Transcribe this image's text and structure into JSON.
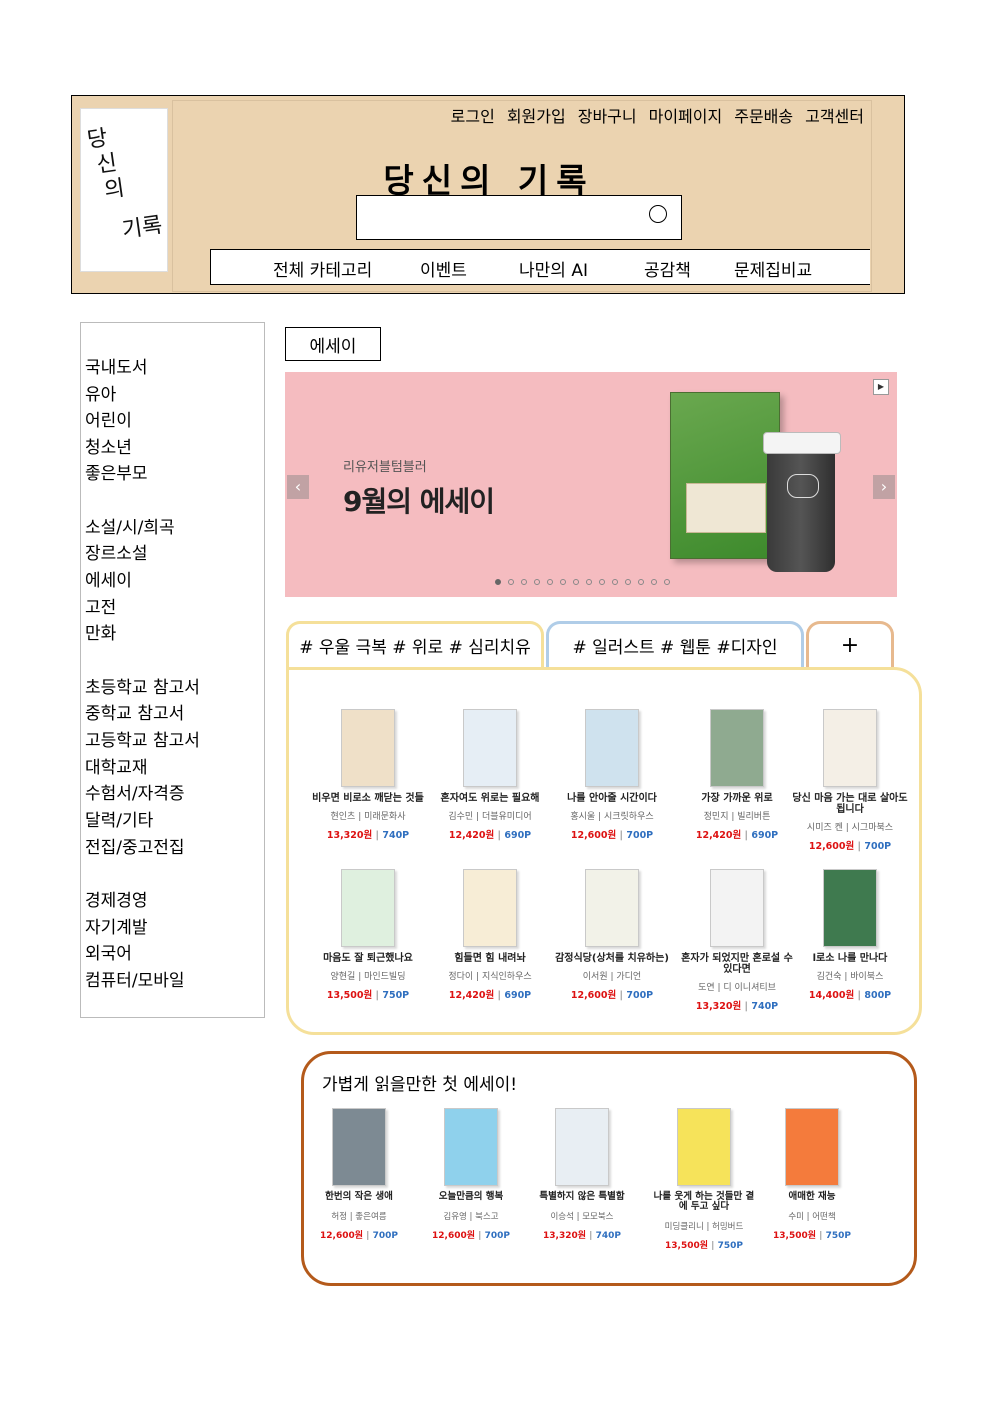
{
  "header": {
    "logo_lines": [
      "당",
      "신",
      "의",
      "기록"
    ],
    "top_links": [
      "로그인",
      "회원가입",
      "장바구니",
      "마이페이지",
      "주문배송",
      "고객센터"
    ],
    "site_title": "당신의 기록",
    "search": {
      "value": "",
      "icon": "search-icon"
    },
    "nav": [
      "전체 카테고리",
      "이벤트",
      "나만의 AI",
      "공감책",
      "문제집비교"
    ],
    "bg_color": "#ebd3b0"
  },
  "sidebar": {
    "groups": [
      [
        "국내도서",
        "유아",
        "어린이",
        "청소년",
        "좋은부모"
      ],
      [
        "소설/시/희곡",
        "장르소설",
        "에세이",
        "고전",
        "만화"
      ],
      [
        "초등학교 참고서",
        "중학교 참고서",
        "고등학교 참고서",
        "대학교재",
        "수험서/자격증",
        "달력/기타",
        "전집/중고전집"
      ],
      [
        "경제경영",
        "자기계발",
        "외국어",
        "컴퓨터/모바일"
      ]
    ]
  },
  "section_label": "에세이",
  "banner": {
    "subtitle": "리유저블텀블러",
    "title": "9월의 에세이",
    "prev": "‹",
    "next": "›",
    "play": "▶",
    "dots": 14,
    "active_dot": 0,
    "bg_color": "#f5bcc0"
  },
  "tabs": [
    {
      "label": "# 우울 극복 # 위로 # 심리치유",
      "border_color": "#f5e09a"
    },
    {
      "label": "# 일러스트 # 웹툰 #디자인",
      "border_color": "#b0cde8"
    },
    {
      "label": "+",
      "border_color": "#e7b98e"
    }
  ],
  "books": [
    {
      "title": "비우면 비로소 깨닫는 것들",
      "author": "현인츠",
      "publisher": "미래문화사",
      "price": "13,320원",
      "points": "740P",
      "cover": "#efe0c8"
    },
    {
      "title": "혼자여도 위로는 필요해",
      "author": "김수민",
      "publisher": "더블유미디어",
      "price": "12,420원",
      "points": "690P",
      "cover": "#e6eef5"
    },
    {
      "title": "나를 안아줄 시간이다",
      "author": "홍시울",
      "publisher": "시크릿하우스",
      "price": "12,600원",
      "points": "700P",
      "cover": "#cfe2ee"
    },
    {
      "title": "가장 가까운 위로",
      "author": "정민지",
      "publisher": "빌리버튼",
      "price": "12,420원",
      "points": "690P",
      "cover": "#8faa90"
    },
    {
      "title": "당신 마음 가는 대로 살아도 됩니다",
      "author": "시미즈 켄",
      "publisher": "시그마북스",
      "price": "12,600원",
      "points": "700P",
      "cover": "#f4efe6"
    },
    {
      "title": "마음도 잘 퇴근했나요",
      "author": "양현길",
      "publisher": "마인드빌딩",
      "price": "13,500원",
      "points": "750P",
      "cover": "#dff0df"
    },
    {
      "title": "힘들면 힘 내려놔",
      "author": "정다이",
      "publisher": "지식인하우스",
      "price": "12,420원",
      "points": "690P",
      "cover": "#f7edd6"
    },
    {
      "title": "감정식당(상처를 치유하는)",
      "author": "이서원",
      "publisher": "가디언",
      "price": "12,600원",
      "points": "700P",
      "cover": "#f2f2e8"
    },
    {
      "title": "혼자가 되었지만 혼로설 수 있다면",
      "author": "도연",
      "publisher": "디 이니셔티브",
      "price": "13,320원",
      "points": "740P",
      "cover": "#f3f3f3"
    },
    {
      "title": "l로소 나를 만나다",
      "author": "김건숙",
      "publisher": "바이북스",
      "price": "14,400원",
      "points": "800P",
      "cover": "#3f7a4f"
    }
  ],
  "light_essay": {
    "title": "가볍게 읽을만한 첫 에세이!",
    "books": [
      {
        "title": "한번의 작은 생애",
        "author": "허정",
        "publisher": "좋은여름",
        "price": "12,600원",
        "points": "700P",
        "cover": "#7d8a93"
      },
      {
        "title": "오늘만큼의 행복",
        "author": "김유영",
        "publisher": "북스고",
        "price": "12,600원",
        "points": "700P",
        "cover": "#8fd1ec"
      },
      {
        "title": "특별하지 않은 특별함",
        "author": "이승석",
        "publisher": "모모북스",
        "price": "13,320원",
        "points": "740P",
        "cover": "#e8eef3"
      },
      {
        "title": "나를 웃게 하는 것들만 곁에 두고 싶다",
        "author": "미딩클리니",
        "publisher": "허밍버드",
        "price": "13,500원",
        "points": "750P",
        "cover": "#f6e35a"
      },
      {
        "title": "애매한 재능",
        "author": "수미",
        "publisher": "어떤책",
        "price": "13,500원",
        "points": "750P",
        "cover": "#f47b3c"
      }
    ],
    "border_color": "#b45a1b"
  }
}
